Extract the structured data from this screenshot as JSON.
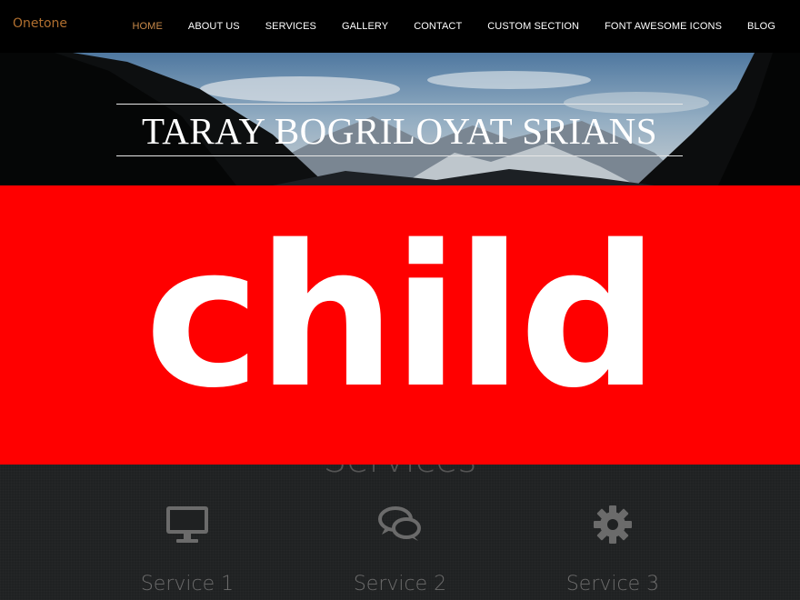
{
  "navbar": {
    "brand": "Onetone",
    "items": [
      {
        "label": "HOME",
        "active": true
      },
      {
        "label": "ABOUT US"
      },
      {
        "label": "SERVICES"
      },
      {
        "label": "GALLERY"
      },
      {
        "label": "CONTACT"
      },
      {
        "label": "CUSTOM SECTION"
      },
      {
        "label": "FONT AWESOME ICONS"
      },
      {
        "label": "BLOG"
      }
    ]
  },
  "hero": {
    "title": "TARAY BOGRILOYAT SRIANS"
  },
  "overlay": {
    "text": "child"
  },
  "services": {
    "heading": "Services",
    "items": [
      {
        "label": "Service 1",
        "icon": "desktop-icon"
      },
      {
        "label": "Service 2",
        "icon": "comments-icon"
      },
      {
        "label": "Service 3",
        "icon": "gear-icon"
      }
    ]
  },
  "colors": {
    "brand": "#b06f2f",
    "nav_active": "#c98a4a",
    "overlay_bg": "#ff0000",
    "services_bg": "#1f2122",
    "icon": "#6b6b6b"
  }
}
